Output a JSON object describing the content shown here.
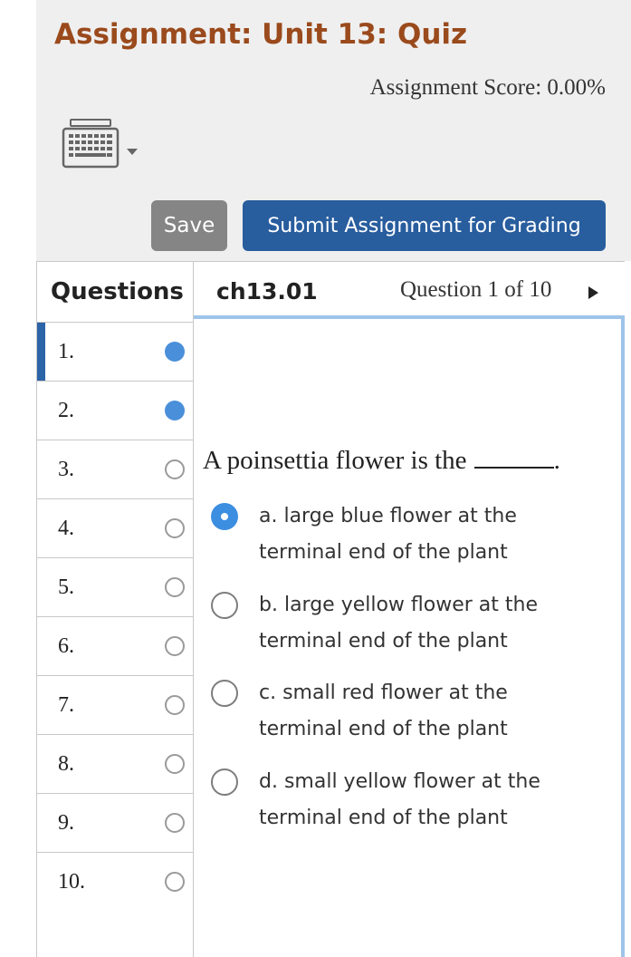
{
  "header": {
    "title": "Assignment: Unit 13: Quiz",
    "score": "Assignment Score: 0.00%",
    "keyboard_icon": "keyboard-icon",
    "save_label": "Save",
    "submit_label": "Submit Assignment for Grading"
  },
  "sidebar": {
    "heading": "Questions",
    "items": [
      {
        "number": "1.",
        "status": "answered",
        "active": true
      },
      {
        "number": "2.",
        "status": "answered",
        "active": false
      },
      {
        "number": "3.",
        "status": "unanswered",
        "active": false
      },
      {
        "number": "4.",
        "status": "unanswered",
        "active": false
      },
      {
        "number": "5.",
        "status": "unanswered",
        "active": false
      },
      {
        "number": "6.",
        "status": "unanswered",
        "active": false
      },
      {
        "number": "7.",
        "status": "unanswered",
        "active": false
      },
      {
        "number": "8.",
        "status": "unanswered",
        "active": false
      },
      {
        "number": "9.",
        "status": "unanswered",
        "active": false
      },
      {
        "number": "10.",
        "status": "unanswered",
        "active": false
      }
    ]
  },
  "question": {
    "code": "ch13.01",
    "position": "Question 1 of 10",
    "stem_prefix": "A poinsettia flower is the",
    "stem_suffix": ".",
    "choices": [
      {
        "label": "a. large blue flower at the terminal end of the plant",
        "selected": true
      },
      {
        "label": "b. large yellow flower at the terminal end of the plant",
        "selected": false
      },
      {
        "label": "c. small red flower at the terminal end of the plant",
        "selected": false
      },
      {
        "label": "d. small yellow flower at the terminal end of the plant",
        "selected": false
      }
    ]
  },
  "colors": {
    "title": "#9a4a1c",
    "submit_button": "#285d9e",
    "save_button": "#858585",
    "active_indicator": "#2c64a8",
    "answered_dot": "#4a8fd9",
    "selected_radio": "#3c8ee0",
    "panel_border": "#9ec4ea"
  }
}
